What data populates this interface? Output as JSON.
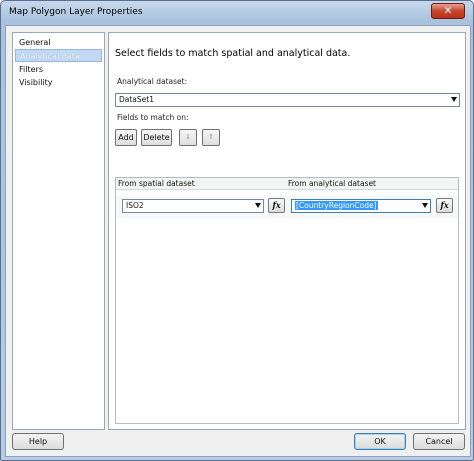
{
  "window": {
    "title": "Map Polygon Layer Properties",
    "close_glyph": "✕"
  },
  "nav": {
    "items": [
      "General",
      "Analytical data",
      "Filters",
      "Visibility"
    ],
    "active_index": 1
  },
  "main": {
    "heading": "Select fields to match spatial and analytical data.",
    "analytical_dataset_label": "Analytical dataset:",
    "analytical_dataset_value": "DataSet1",
    "fields_label": "Fields to match on:",
    "add_label": "Add",
    "delete_label": "Delete",
    "move_down_glyph": "⇓",
    "move_up_glyph": "⇑",
    "grid": {
      "headers": [
        "From spatial dataset",
        "From analytical dataset"
      ],
      "rows": [
        {
          "spatial": "ISO2",
          "analytical": "[CountryRegionCode]"
        }
      ],
      "fx_glyph": "fx"
    }
  },
  "footer": {
    "help": "Help",
    "ok": "OK",
    "cancel": "Cancel"
  },
  "colors": {
    "selection": "#3399ff",
    "nav_active": "#c3d9f3"
  }
}
